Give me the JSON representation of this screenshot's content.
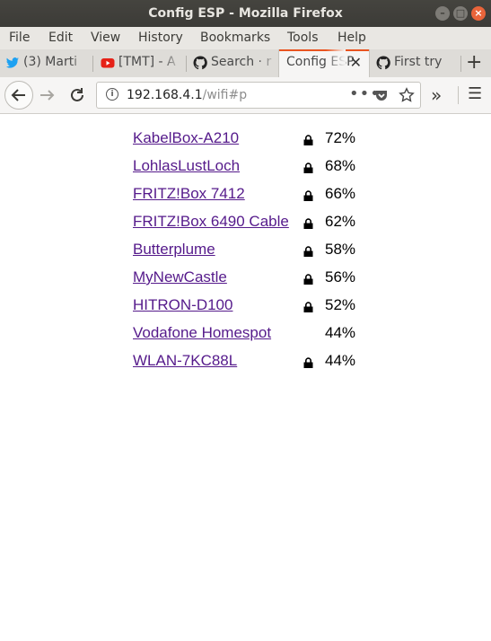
{
  "window": {
    "title": "Config ESP - Mozilla Firefox"
  },
  "menu": [
    "File",
    "Edit",
    "View",
    "History",
    "Bookmarks",
    "Tools",
    "Help"
  ],
  "tabs": [
    {
      "label": "(3) Marti",
      "icon": "twitter-icon",
      "active": false
    },
    {
      "label": "[TMT] - A",
      "icon": "youtube-icon",
      "active": false
    },
    {
      "label": "Search · r",
      "icon": "github-icon",
      "active": false
    },
    {
      "label": "Config ESP",
      "icon": "none",
      "active": true
    },
    {
      "label": "First try",
      "icon": "github-icon",
      "active": false
    }
  ],
  "nav": {
    "url_host": "192.168.4.1",
    "url_path": "/wifi#p"
  },
  "networks": [
    {
      "ssid": "KabelBox-A210",
      "secured": true,
      "signal": "72%"
    },
    {
      "ssid": "LohlasLustLoch",
      "secured": true,
      "signal": "68%"
    },
    {
      "ssid": "FRITZ!Box 7412",
      "secured": true,
      "signal": "66%"
    },
    {
      "ssid": "FRITZ!Box 6490 Cable",
      "secured": true,
      "signal": "62%"
    },
    {
      "ssid": "Butterplume",
      "secured": true,
      "signal": "58%"
    },
    {
      "ssid": "MyNewCastle",
      "secured": true,
      "signal": "56%"
    },
    {
      "ssid": "HITRON-D100",
      "secured": true,
      "signal": "52%"
    },
    {
      "ssid": "Vodafone Homespot",
      "secured": false,
      "signal": "44%"
    },
    {
      "ssid": "WLAN-7KC88L",
      "secured": true,
      "signal": "44%"
    }
  ],
  "colors": {
    "accent": "#e95420",
    "link": "#551a8b",
    "titlebar": "#3c3b37"
  }
}
